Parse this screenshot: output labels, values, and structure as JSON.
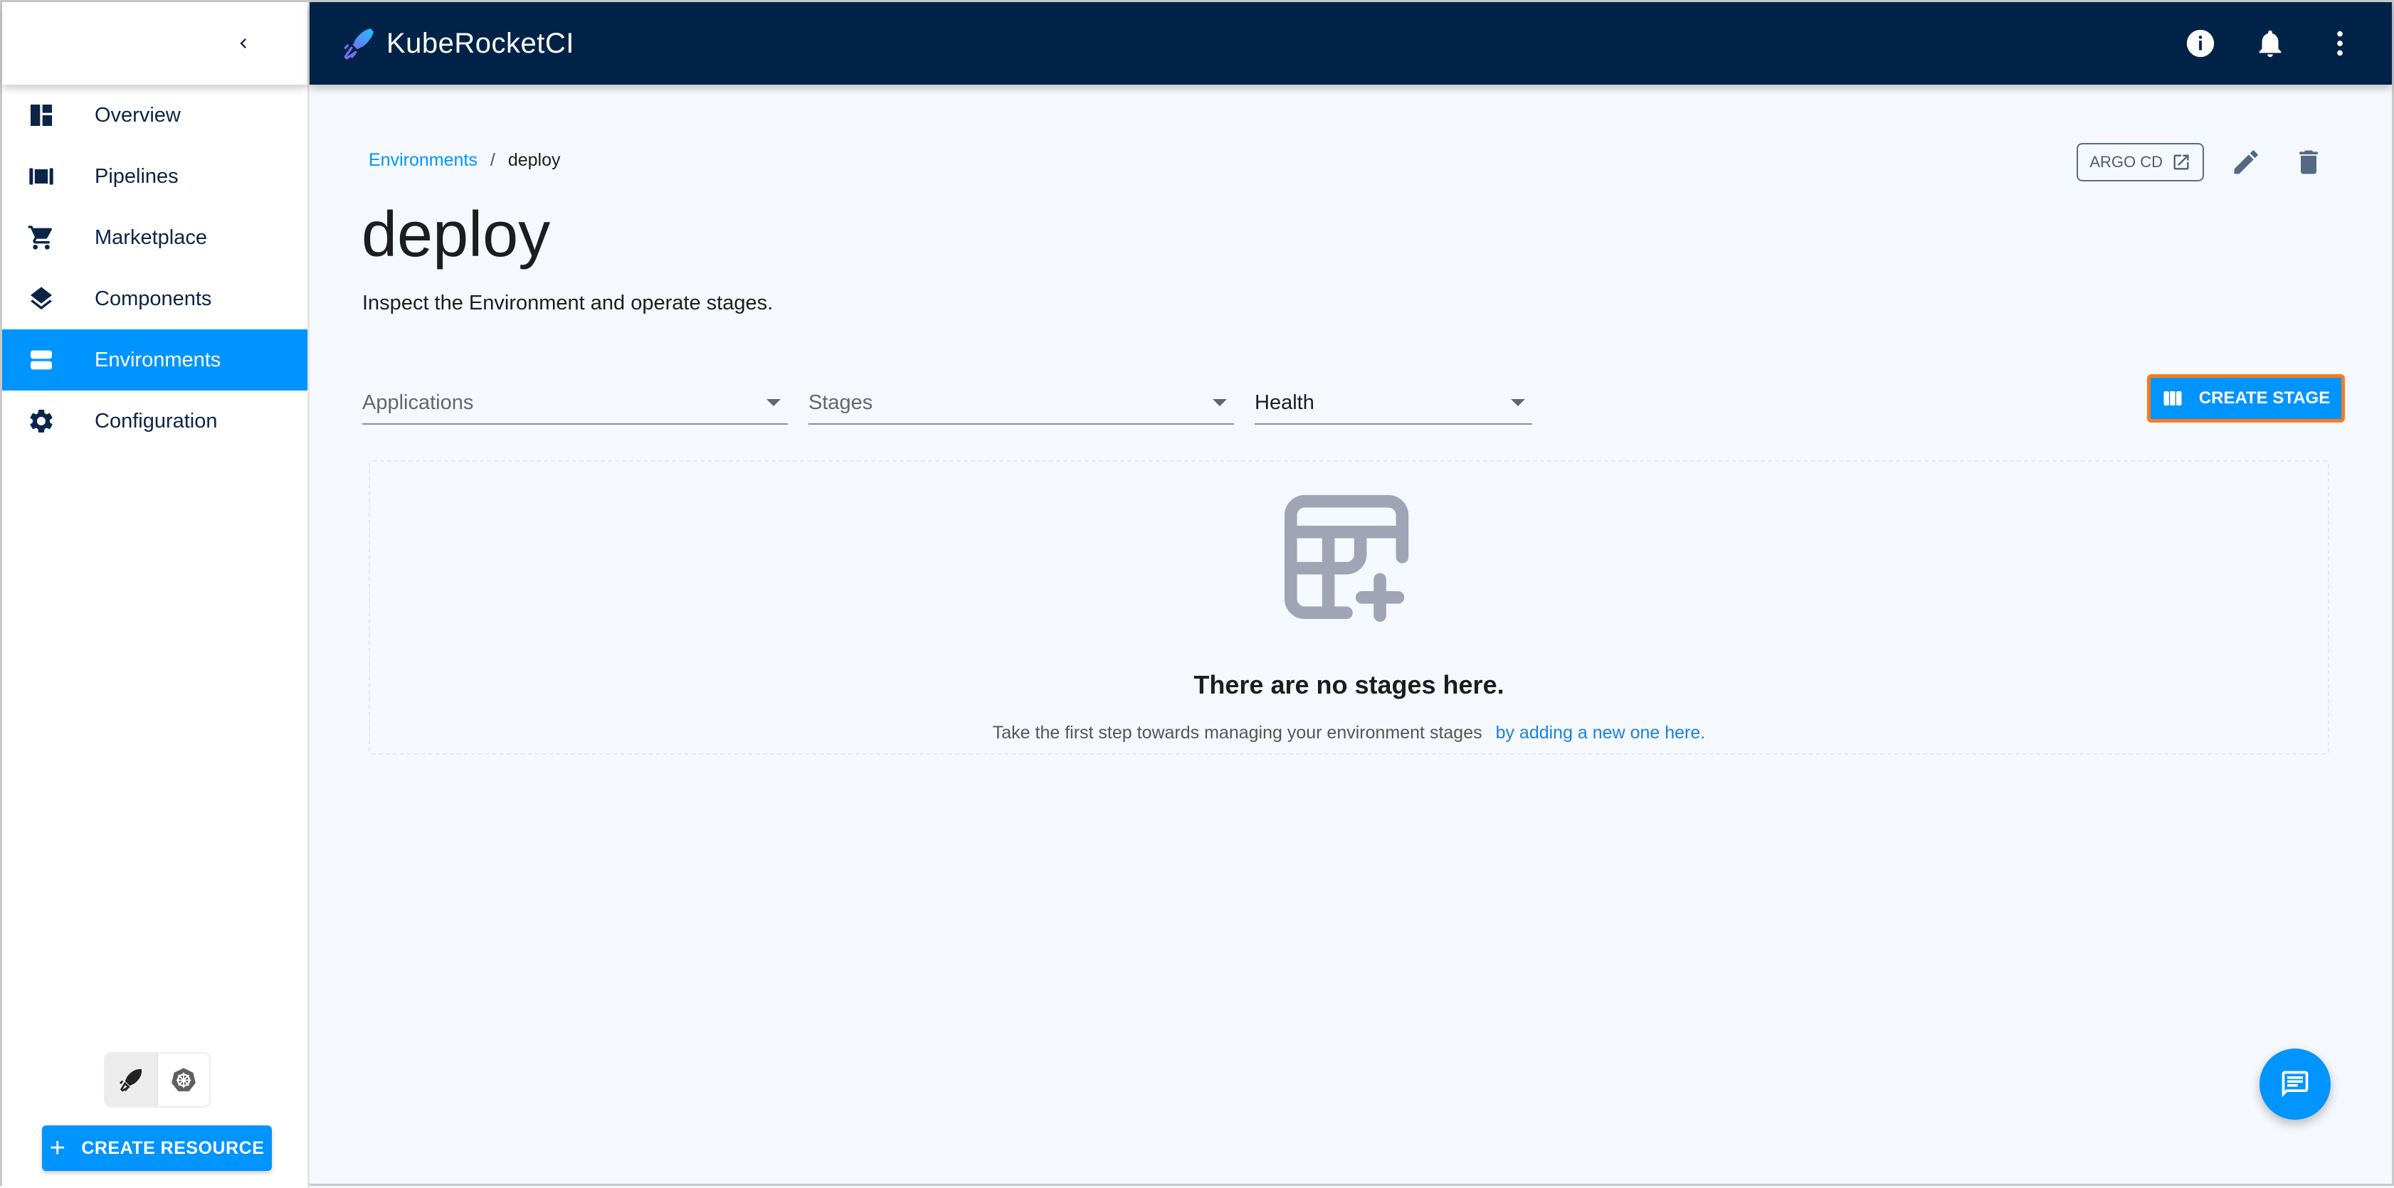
{
  "app": {
    "title": "KubeRocketCI"
  },
  "header": {
    "logo_text": "KubeRocketCI",
    "actions": [
      {
        "icon": "info-icon",
        "label": "Info"
      },
      {
        "icon": "bell-icon",
        "label": "Notifications"
      },
      {
        "icon": "more-vert-icon",
        "label": "More"
      }
    ]
  },
  "sidebar": {
    "collapse_icon": "chevron-left-icon",
    "items": [
      {
        "label": "Overview",
        "icon": "dashboard-icon",
        "active": false
      },
      {
        "label": "Pipelines",
        "icon": "pipelines-icon",
        "active": false
      },
      {
        "label": "Marketplace",
        "icon": "cart-icon",
        "active": false
      },
      {
        "label": "Components",
        "icon": "layers-icon",
        "active": false
      },
      {
        "label": "Environments",
        "icon": "environments-icon",
        "active": true
      },
      {
        "label": "Configuration",
        "icon": "gear-icon",
        "active": false
      }
    ],
    "mode_toggle": [
      {
        "icon": "rocket-icon",
        "selected": true
      },
      {
        "icon": "kubernetes-icon",
        "selected": false
      }
    ],
    "create_resource_label": "CREATE RESOURCE"
  },
  "breadcrumb": {
    "parent": "Environments",
    "separator": "/",
    "current": "deploy"
  },
  "page": {
    "title": "deploy",
    "subtitle": "Inspect the Environment and operate stages."
  },
  "top_actions": {
    "argo_label": "ARGO CD",
    "edit_icon": "pencil-icon",
    "delete_icon": "trash-icon"
  },
  "filters": {
    "applications": {
      "label": "Applications",
      "value": ""
    },
    "stages": {
      "label": "Stages",
      "value": ""
    },
    "health": {
      "label": "Health",
      "value": ""
    }
  },
  "create_stage_label": "CREATE STAGE",
  "empty_state": {
    "icon": "table-add-icon",
    "title": "There are no stages here.",
    "description": "Take the first step towards managing your environment stages",
    "link_text": "by adding a new one here."
  },
  "fab": {
    "icon": "chat-icon"
  },
  "colors": {
    "header_bg": "#002347",
    "accent": "#0094ff",
    "highlight_outline": "#ff7a1a",
    "page_bg": "#f5f9fd",
    "nav_text": "#0b2447"
  }
}
